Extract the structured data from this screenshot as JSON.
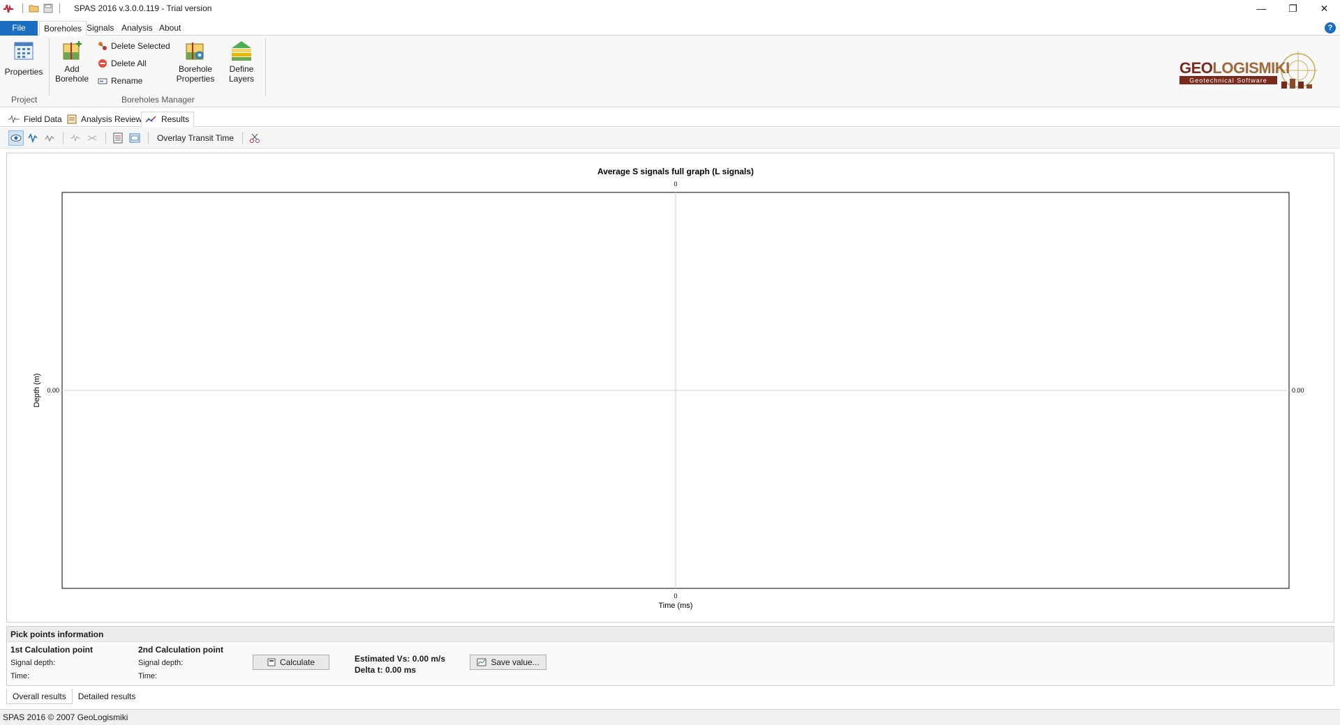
{
  "window": {
    "title": "SPAS 2016 v.3.0.0.119 - Trial version",
    "minimize": "—",
    "restore": "❐",
    "close": "✕"
  },
  "menu": {
    "file": "File",
    "tabs": [
      "Boreholes",
      "Signals",
      "Analysis",
      "About"
    ],
    "help": "?"
  },
  "ribbon": {
    "project": {
      "label": "Project",
      "properties": "Properties"
    },
    "boreholes_manager": {
      "label": "Boreholes Manager",
      "add_borehole": [
        "Add",
        "Borehole"
      ],
      "delete_selected": "Delete Selected",
      "delete_all": "Delete All",
      "rename": "Rename",
      "borehole_properties": [
        "Borehole",
        "Properties"
      ],
      "define_layers": [
        "Define",
        "Layers"
      ]
    }
  },
  "logo": {
    "name": "GEOLOGISMIKI",
    "tagline": "Geotechnical Software"
  },
  "view_tabs": [
    "Field Data",
    "Analysis Review",
    "Results"
  ],
  "toolbar": {
    "overlay_label": "Overlay Transit Time"
  },
  "chart_data": {
    "type": "line",
    "title": "Average S signals full graph (L signals)",
    "xlabel": "Time (ms)",
    "ylabel": "Depth (m)",
    "x_ticks": [
      "0"
    ],
    "y_ticks": [
      "0.00"
    ],
    "series": [],
    "grid": true
  },
  "pick_points": {
    "header": "Pick points information",
    "first": {
      "title": "1st Calculation point",
      "signal_depth": "Signal depth:",
      "time": "Time:"
    },
    "second": {
      "title": "2nd Calculation point",
      "signal_depth": "Signal depth:",
      "time": "Time:"
    },
    "calculate": "Calculate",
    "estimated_vs": "Estimated Vs: 0.00 m/s",
    "delta_t": "Delta t: 0.00 ms",
    "save_value": "Save value..."
  },
  "bottom_tabs": [
    "Overall results",
    "Detailed results"
  ],
  "status": "SPAS 2016 © 2007 GeoLogismiki"
}
